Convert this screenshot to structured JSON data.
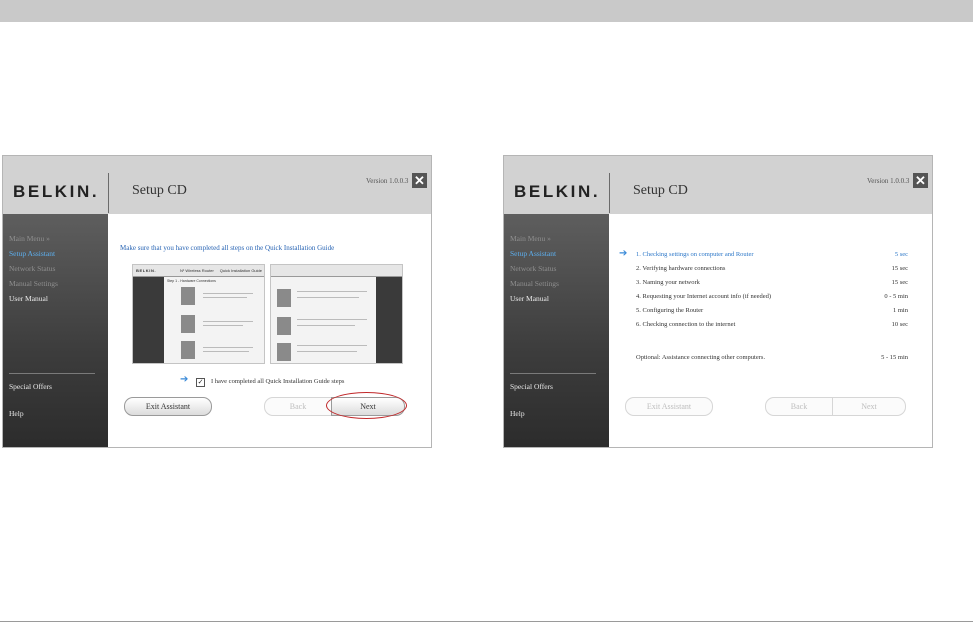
{
  "left_window": {
    "logo": "BELKIN.",
    "title": "Setup CD",
    "version": "Version 1.0.0.3",
    "close": "✕",
    "sidebar": {
      "items": [
        {
          "label": "Main Menu  »"
        },
        {
          "label": "Setup Assistant"
        },
        {
          "label": "Network Status"
        },
        {
          "label": "Manual Settings"
        },
        {
          "label": "User Manual"
        },
        {
          "label": "Special Offers"
        },
        {
          "label": "Help"
        }
      ]
    },
    "instruction": "Make sure that you have completed all steps on the Quick Installation Guide",
    "thumb": {
      "logo": "BELKIN.",
      "product": "N¹ Wireless Router",
      "guide": "Quick Installation Guide",
      "step": "Step 1 - Hardware Connections"
    },
    "checkbox": {
      "checked_glyph": "✓",
      "label": "I have completed all Quick Installation Guide steps"
    },
    "buttons": {
      "exit": "Exit Assistant",
      "back": "Back",
      "next": "Next"
    }
  },
  "right_window": {
    "logo": "BELKIN.",
    "title": "Setup CD",
    "version": "Version 1.0.0.3",
    "close": "✕",
    "sidebar": {
      "items": [
        {
          "label": "Main Menu  »"
        },
        {
          "label": "Setup Assistant"
        },
        {
          "label": "Network Status"
        },
        {
          "label": "Manual Settings"
        },
        {
          "label": "User Manual"
        },
        {
          "label": "Special Offers"
        },
        {
          "label": "Help"
        }
      ]
    },
    "steps": [
      {
        "label": "1. Checking settings on computer and Router",
        "time": "5 sec"
      },
      {
        "label": "2. Verifying hardware connections",
        "time": "15 sec"
      },
      {
        "label": "3. Naming your network",
        "time": "15 sec"
      },
      {
        "label": "4. Requesting your Internet account info (if needed)",
        "time": "0 - 5 min"
      },
      {
        "label": "5. Configuring the Router",
        "time": "1 min"
      },
      {
        "label": "6. Checking connection to the internet",
        "time": "10 sec"
      }
    ],
    "optional": {
      "label": "Optional: Assistance connecting other computers.",
      "time": "5 - 15 min"
    },
    "buttons": {
      "exit": "Exit Assistant",
      "back": "Back",
      "next": "Next"
    }
  },
  "colors": {
    "accent": "#2e78c8",
    "sidebar_active": "#5db0f0",
    "highlight_circle": "#c0282a"
  }
}
